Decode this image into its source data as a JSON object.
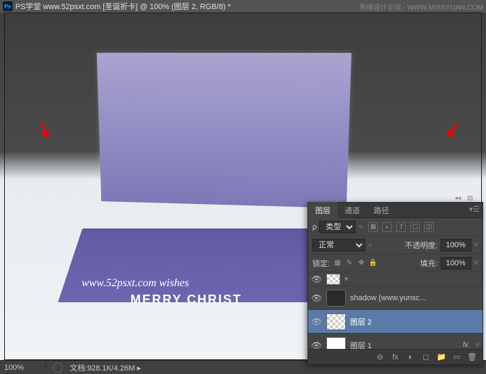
{
  "title_bar": {
    "app": "Ps",
    "title": "PS学堂  www.52psxt.com [圣诞折卡] @ 100% (图层 2, RGB/8) *",
    "watermark": "思缘设计论坛 - WWW.MISSYUAN.COM"
  },
  "canvas": {
    "text1": "www.52psxt.com   wishes",
    "text2": "MERRY CHRIST"
  },
  "status": {
    "zoom": "100%",
    "doc_label": "文档:",
    "doc_value": "928.1K/4.26M"
  },
  "panel": {
    "tabs": {
      "layers": "图层",
      "channels": "通道",
      "paths": "路径"
    },
    "filter": {
      "kind_icon": "ρ",
      "kind_label": "类型",
      "icons": [
        "▦",
        "◐",
        "T",
        "▢",
        "◫"
      ]
    },
    "blend": {
      "mode": "正常",
      "opacity_label": "不透明度:",
      "opacity": "100%"
    },
    "lock": {
      "label": "锁定:",
      "icons": [
        "▦",
        "✎",
        "✥",
        "🔒"
      ],
      "fill_label": "填充:",
      "fill": "100%"
    },
    "layers": [
      {
        "name": "",
        "thumb": "checker",
        "visible": true
      },
      {
        "name": "shadow (www.yunsc...",
        "thumb": "dark",
        "visible": true
      },
      {
        "name": "图层 2",
        "thumb": "checker",
        "visible": true,
        "selected": true
      },
      {
        "name": "图层 1",
        "thumb": "white",
        "visible": true,
        "fx": "fx"
      }
    ],
    "footer_icons": [
      "⊖",
      "fx",
      "◐",
      "◻",
      "▭",
      "🗑"
    ]
  }
}
